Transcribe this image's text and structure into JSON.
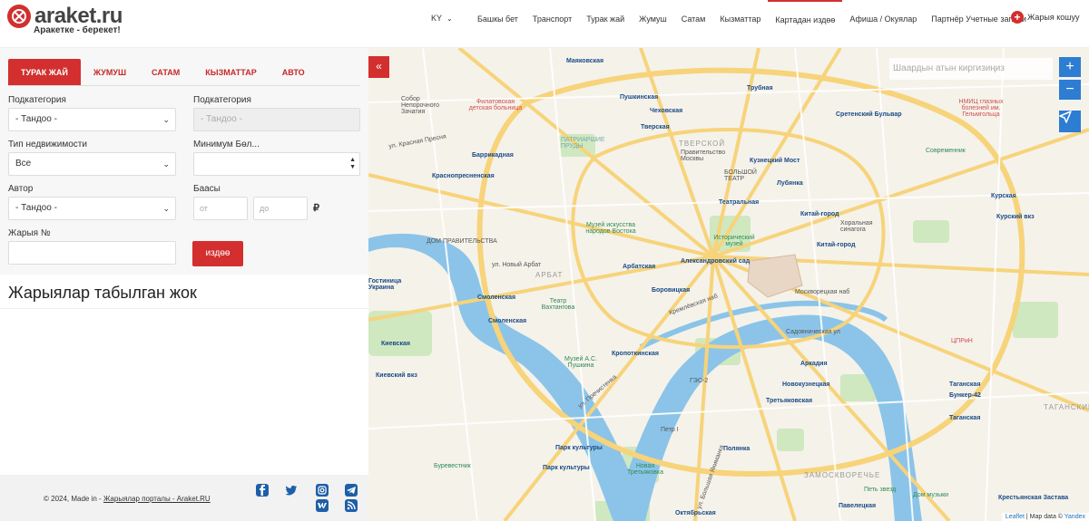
{
  "header": {
    "logo_text": "araket.ru",
    "tagline": "Аракетке - берекет!",
    "lang": "KY",
    "nav": [
      "Башкы бет",
      "Транспорт",
      "Турак жай",
      "Жумуш",
      "Сатам",
      "Кызматтар",
      "Картадан издөө",
      "Афиша / Окуялар",
      "Партнёр Учетные записи"
    ],
    "active_nav": "Картадан издөө",
    "post_label": "Жарыя кошуу"
  },
  "filters": {
    "tabs": [
      "ТУРАК ЖАЙ",
      "ЖУМУШ",
      "САТАМ",
      "КЫЗМАТТАР",
      "АВТО"
    ],
    "subcategory_label": "Подкатегория",
    "subcategory_value": "- Тандоо -",
    "subcategory2_label": "Подкатегория",
    "subcategory2_value": "- Тандоо -",
    "property_type_label": "Тип недвижимости",
    "property_type_value": "Все",
    "min_rooms_label": "Минимум Бөл...",
    "author_label": "Автор",
    "author_value": "- Тандоо -",
    "price_label": "Баасы",
    "price_from_placeholder": "от",
    "price_to_placeholder": "до",
    "currency": "₽",
    "ad_number_label": "Жарыя №",
    "search_button": "издөө"
  },
  "results": {
    "text": "Жарыялар табылган жок"
  },
  "footer": {
    "copyright": "© 2024, Made in -",
    "portal_link": "Жарыялар порталы - Araket.RU"
  },
  "map": {
    "collapse": "«",
    "search_placeholder": "Шаардын атын киргизиңиз",
    "zoom_in": "+",
    "zoom_out": "−",
    "attrib_leaflet": "Leaflet",
    "attrib_sep": " | Map data © ",
    "attrib_yandex": "Yandex",
    "labels": {
      "mayakovskaya": "Маяковская",
      "pushkinskaya": "Пушкинская",
      "chekhovskaya": "Чеховская",
      "tverskaya": "Тверская",
      "trubnaya": "Трубная",
      "sretensky": "Сретенский Бульвар",
      "barrikadnaya": "Баррикадная",
      "krasnopresnenskaya": "Краснопресненская",
      "tverskoy": "ТВЕРСКОЙ",
      "kuznetsky": "Кузнецкий Мост",
      "lubyanka": "Лубянка",
      "teatralnaya": "Театральная",
      "kitay1": "Китай-город",
      "kitay2": "Китай-город",
      "arbat": "АРБАТ",
      "arbatskaya": "Арбатская",
      "alexandrovsky": "Александровский сад",
      "borovitskaya": "Боровицкая",
      "smolenskaya1": "Смоленская",
      "smolenskaya2": "Смоленская",
      "kievskaya": "Киевская",
      "kropotkinskaya": "Кропоткинская",
      "arkadia": "Аркадия",
      "novokuznetskaya": "Новокузнецкая",
      "tretyakovskaya": "Третьяковская",
      "polyanka": "Полянка",
      "park1": "Парк культуры",
      "park2": "Парк культуры",
      "zamoskvorechye": "ЗАМОСКВОРЕЧЬЕ",
      "kurskaya": "Курская",
      "taganskaya1": "Таганская",
      "taganskaya2": "Таганская",
      "taganskiy": "ТАГАНСКИЙ",
      "paveletskaya": "Павелецкая",
      "oktyabrskaya": "Октябрьская",
      "krestyanskaya": "Крестьянская Застава",
      "bunker": "Бункер-42",
      "dom_prav": "ДОМ ПРАВИТЕЛЬСТВА",
      "muzey_vostoka": "Музей искусства народов Востока",
      "muzey_pushkina": "Музей А.С. Пушкина",
      "ist_muzey": "Исторический музей",
      "teatr_vakht": "Театр Вахтангова",
      "novaya_tret": "Новая Третьяковка",
      "burevestnik": "Буревестник",
      "ges": "ГЭС-2",
      "petr": "Петр I",
      "sovremennik": "Современник",
      "horal": "Хоральная синагога",
      "sobor": "Собор Непорочного Зачатия",
      "filatov": "Филатовская детская больница",
      "petsvezd": "Петь звезд",
      "domm": "Дом музыки",
      "tsirin": "ЦПРиН",
      "gostinitsa": "Гостиница Украина",
      "kievvokzal": "Киевский вкз",
      "kurskiy_vkz": "Курский вкз",
      "patr": "ПАТРИАРШИЕ ПРУДЫ",
      "pravmos": "Правительство Москвы",
      "bolshoi": "БОЛЬШОЙ ТЕАТР",
      "nmits": "НМИЦ глазных болезней им. Гельмгольца",
      "ul_krasn": "ул. Красная Пресня",
      "novy_arbat": "ул. Новый Арбат",
      "moskvoretskaya": "Москворецкая наб",
      "kremlevskaya": "Кремлёвская наб",
      "sadovnich": "Садовническая ул",
      "bolshaya_yakim": "ул. Большая Якиманка",
      "prechistenka": "ул. Пречистенка"
    }
  }
}
